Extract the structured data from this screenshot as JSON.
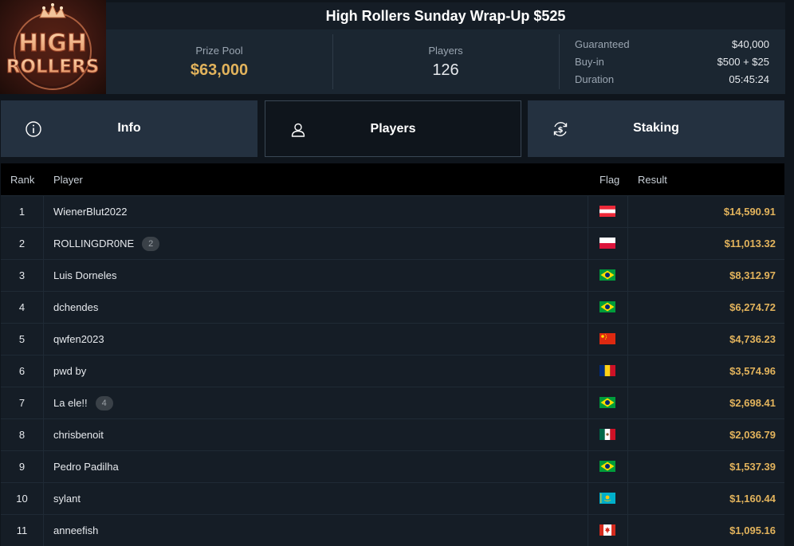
{
  "tournament": {
    "title": "High Rollers Sunday Wrap-Up $525",
    "logo_text_line1": "HIGH",
    "logo_text_line2": "ROLLERS"
  },
  "stats": {
    "prize_pool_label": "Prize Pool",
    "prize_pool_value": "$63,000",
    "players_label": "Players",
    "players_value": "126",
    "guaranteed_label": "Guaranteed",
    "guaranteed_value": "$40,000",
    "buyin_label": "Buy-in",
    "buyin_value": "$500 + $25",
    "duration_label": "Duration",
    "duration_value": "05:45:24"
  },
  "tabs": [
    {
      "label": "Info",
      "icon": "info-icon"
    },
    {
      "label": "Players",
      "icon": "user-icon"
    },
    {
      "label": "Staking",
      "icon": "dollar-refresh-icon"
    }
  ],
  "table": {
    "columns": {
      "rank": "Rank",
      "player": "Player",
      "flag": "Flag",
      "result": "Result"
    },
    "rows": [
      {
        "rank": "1",
        "player": "WienerBlut2022",
        "badge": "",
        "flag": "austria",
        "result": "$14,590.91"
      },
      {
        "rank": "2",
        "player": "ROLLINGDR0NE",
        "badge": "2",
        "flag": "poland",
        "result": "$11,013.32"
      },
      {
        "rank": "3",
        "player": "Luis Dorneles",
        "badge": "",
        "flag": "brazil",
        "result": "$8,312.97"
      },
      {
        "rank": "4",
        "player": "dchendes",
        "badge": "",
        "flag": "brazil",
        "result": "$6,274.72"
      },
      {
        "rank": "5",
        "player": "qwfen2023",
        "badge": "",
        "flag": "china",
        "result": "$4,736.23"
      },
      {
        "rank": "6",
        "player": "pwd by",
        "badge": "",
        "flag": "romania",
        "result": "$3,574.96"
      },
      {
        "rank": "7",
        "player": "La ele!!",
        "badge": "4",
        "flag": "brazil",
        "result": "$2,698.41"
      },
      {
        "rank": "8",
        "player": "chrisbenoit",
        "badge": "",
        "flag": "mexico",
        "result": "$2,036.79"
      },
      {
        "rank": "9",
        "player": "Pedro Padilha",
        "badge": "",
        "flag": "brazil",
        "result": "$1,537.39"
      },
      {
        "rank": "10",
        "player": "sylant",
        "badge": "",
        "flag": "kazakhstan",
        "result": "$1,160.44"
      },
      {
        "rank": "11",
        "player": "anneefish",
        "badge": "",
        "flag": "canada",
        "result": "$1,095.16"
      }
    ]
  },
  "colors": {
    "gold": "#e2b35c",
    "panel": "#1b2631",
    "tab": "#243140",
    "row": "#151d26"
  }
}
